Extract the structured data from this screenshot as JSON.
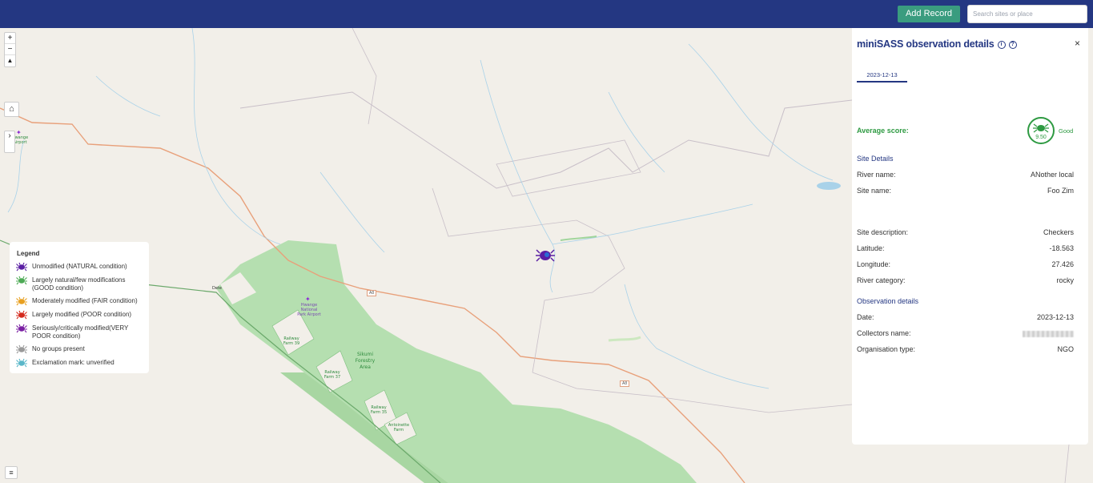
{
  "header": {
    "add_record_label": "Add Record",
    "search_placeholder": "Search sites or place"
  },
  "map_controls": {
    "zoom_in": "+",
    "zoom_out": "−",
    "reset_north": "▲",
    "home": "⌂",
    "sidebar_toggle": "›",
    "layers": "≡"
  },
  "map_labels": {
    "airport_left": "Hwange Airport",
    "dete": "Dete",
    "national_park_airport": "Hwange National Park Airport",
    "railway_farm_39": "Railway Farm 39",
    "railway_farm_37": "Railway Farm 37",
    "railway_farm_35": "Railway Farm 35",
    "antoinette_farm": "Antoinette Farm",
    "sikumi": "Sikumi Forestry Area",
    "road_a8_1": "A8",
    "road_a8_2": "A8"
  },
  "legend": {
    "title": "Legend",
    "items": [
      {
        "label": "Unmodified (NATURAL condition)",
        "color": "#5a1fa3"
      },
      {
        "label": "Largely natural/few modifications (GOOD condition)",
        "color": "#4daa55"
      },
      {
        "label": "Moderately modified (FAIR condition)",
        "color": "#e8a020"
      },
      {
        "label": "Largely modified (POOR condition)",
        "color": "#d42a1e"
      },
      {
        "label": "Seriously/critically modified(VERY POOR condition)",
        "color": "#7a1fa3"
      },
      {
        "label": "No groups present",
        "color": "#9a9a9a"
      },
      {
        "label": "Exclamation mark: unverified",
        "color": "#5ab7c9"
      }
    ]
  },
  "panel": {
    "title": "miniSASS observation details",
    "title_icons": [
      "info-icon",
      "help-icon"
    ],
    "close_label": "×",
    "date_tab": "2023-12-13",
    "average_score_label": "Average score:",
    "average_score_value": "9.50",
    "average_condition": "Good",
    "score_color": "#2e9a42",
    "site_details_heading": "Site Details",
    "river_name_label": "River name:",
    "river_name": "ANother local",
    "site_name_label": "Site name:",
    "site_name": "Foo Zim",
    "site_description_label": "Site description:",
    "site_description": "Checkers",
    "latitude_label": "Latitude:",
    "latitude": "-18.563",
    "longitude_label": "Longitude:",
    "longitude": "27.426",
    "river_category_label": "River category:",
    "river_category": "rocky",
    "observation_heading": "Observation details",
    "date_label": "Date:",
    "date": "2023-12-13",
    "collectors_label": "Collectors name:",
    "organisation_label": "Organisation type:",
    "organisation_type": "NGO"
  },
  "colors": {
    "topbar": "#243782",
    "accent_button": "#3a9c7f",
    "forest": "#b5dfb0",
    "road": "#e8a07a",
    "river": "#a9d2e9"
  }
}
